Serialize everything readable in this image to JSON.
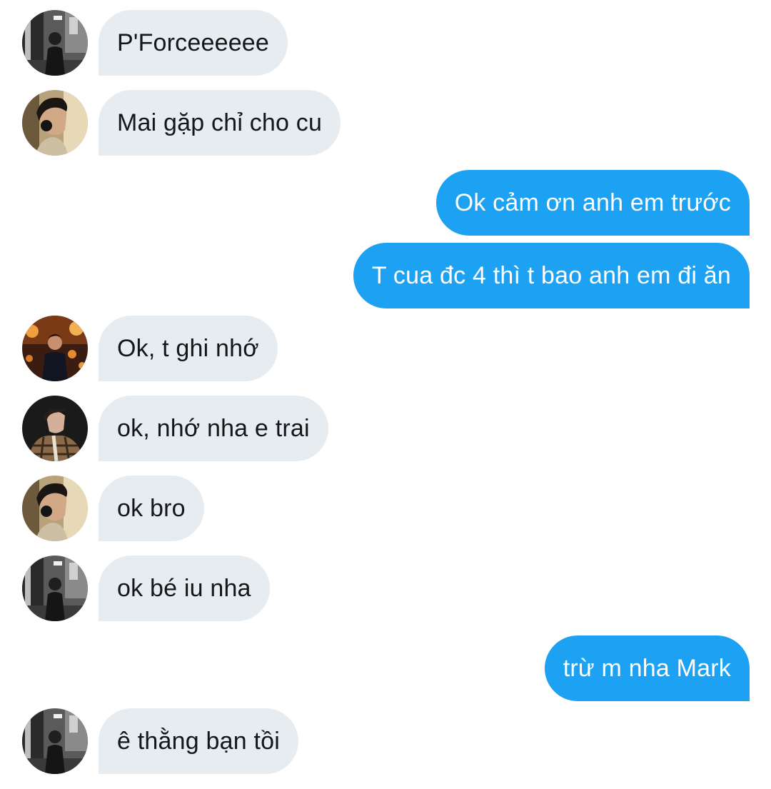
{
  "conversation": {
    "messages": [
      {
        "direction": "in",
        "avatar": "bw-street-avatar",
        "text": "P'Forceeeeee"
      },
      {
        "direction": "in",
        "avatar": "headphones-avatar",
        "text": "Mai gặp chỉ cho cu"
      },
      {
        "direction": "out",
        "text": "Ok cảm ơn anh em trước"
      },
      {
        "direction": "out",
        "text": "T cua đc 4 thì t bao anh em đi ăn"
      },
      {
        "direction": "in",
        "avatar": "night-lights-avatar",
        "text": "Ok, t ghi nhớ"
      },
      {
        "direction": "in",
        "avatar": "plaid-jacket-avatar",
        "text": "ok, nhớ nha e trai"
      },
      {
        "direction": "in",
        "avatar": "headphones-avatar",
        "text": "ok bro"
      },
      {
        "direction": "in",
        "avatar": "bw-street-avatar",
        "text": "ok bé iu nha"
      },
      {
        "direction": "out",
        "text": "trừ m nha Mark"
      },
      {
        "direction": "in",
        "avatar": "bw-street-avatar",
        "text": "ê thằng bạn tồi"
      }
    ]
  },
  "colors": {
    "incoming_bubble": "#e6ecf0",
    "incoming_text": "#14171a",
    "outgoing_bubble": "#1da1f2",
    "outgoing_text": "#ffffff",
    "background": "#ffffff"
  }
}
